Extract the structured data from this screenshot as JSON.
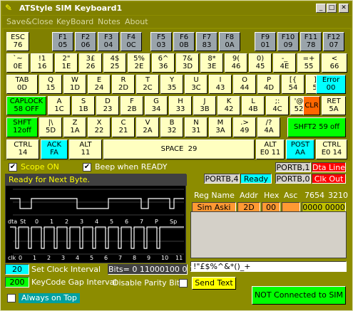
{
  "window": {
    "title": "ATStyle SIM Keyboard1"
  },
  "menu": [
    "Save&Close",
    "KeyBoard",
    "Notes",
    "About"
  ],
  "keyboard": {
    "row0": [
      {
        "t": "ESC",
        "c": "76"
      },
      {
        "t": "F1",
        "c": "05"
      },
      {
        "t": "F2",
        "c": "06"
      },
      {
        "t": "F3",
        "c": "04"
      },
      {
        "t": "F4",
        "c": "0C"
      },
      {
        "t": "F5",
        "c": "03"
      },
      {
        "t": "F6",
        "c": "0B"
      },
      {
        "t": "F7",
        "c": "83"
      },
      {
        "t": "F8",
        "c": "0A"
      },
      {
        "t": "F9",
        "c": "01"
      },
      {
        "t": "F10",
        "c": "09"
      },
      {
        "t": "F11",
        "c": "78"
      },
      {
        "t": "F12",
        "c": "07"
      }
    ],
    "row1": [
      {
        "t": "`~",
        "c": "0E"
      },
      {
        "t": "!1",
        "c": "16"
      },
      {
        "t": "2\"",
        "c": "1E"
      },
      {
        "t": "3£",
        "c": "26"
      },
      {
        "t": "4$",
        "c": "25"
      },
      {
        "t": "5%",
        "c": "2E"
      },
      {
        "t": "6^",
        "c": "36"
      },
      {
        "t": "7&",
        "c": "3D"
      },
      {
        "t": "8*",
        "c": "3E"
      },
      {
        "t": "9(",
        "c": "46"
      },
      {
        "t": "0)",
        "c": "45"
      },
      {
        "t": "-_",
        "c": "4E"
      },
      {
        "t": "=+",
        "c": "55"
      },
      {
        "t": "<",
        "c": "66"
      }
    ],
    "row2": [
      {
        "t": "TAB",
        "c": "0D"
      },
      {
        "t": "Q",
        "c": "15"
      },
      {
        "t": "W",
        "c": "1D"
      },
      {
        "t": "E",
        "c": "24"
      },
      {
        "t": "R",
        "c": "2D"
      },
      {
        "t": "T",
        "c": "2C"
      },
      {
        "t": "Y",
        "c": "35"
      },
      {
        "t": "U",
        "c": "3C"
      },
      {
        "t": "I",
        "c": "43"
      },
      {
        "t": "O",
        "c": "44"
      },
      {
        "t": "P",
        "c": "4D"
      },
      {
        "t": "[{",
        "c": "54"
      },
      {
        "t": "]}",
        "c": "5B"
      },
      {
        "t": "Error",
        "c": "00"
      }
    ],
    "row3": [
      {
        "t": "CAPLOCK",
        "c": "58 OFF"
      },
      {
        "t": "A",
        "c": "1C"
      },
      {
        "t": "S",
        "c": "1B"
      },
      {
        "t": "D",
        "c": "23"
      },
      {
        "t": "F",
        "c": "2B"
      },
      {
        "t": "G",
        "c": "34"
      },
      {
        "t": "H",
        "c": "33"
      },
      {
        "t": "J",
        "c": "3B"
      },
      {
        "t": "K",
        "c": "42"
      },
      {
        "t": "L",
        "c": "4B"
      },
      {
        "t": ";:",
        "c": "4C"
      },
      {
        "t": "'@",
        "c": "52"
      },
      {
        "t": "CLR",
        "c": ""
      },
      {
        "t": "RET",
        "c": "5A"
      }
    ],
    "row4": [
      {
        "t": "SHFT",
        "c": "12off"
      },
      {
        "t": "|\\",
        "c": "5D"
      },
      {
        "t": "Z",
        "c": "1A"
      },
      {
        "t": "X",
        "c": "22"
      },
      {
        "t": "C",
        "c": "21"
      },
      {
        "t": "V",
        "c": "2A"
      },
      {
        "t": "B",
        "c": "32"
      },
      {
        "t": "N",
        "c": "31"
      },
      {
        "t": "M",
        "c": "3A"
      },
      {
        "t": ",<",
        "c": "41"
      },
      {
        "t": ".>",
        "c": "49"
      },
      {
        "t": "/?",
        "c": "4A"
      },
      {
        "t": "SHFT2 59 off",
        "c": ""
      }
    ],
    "row5": [
      {
        "t": "CTRL",
        "c": "14"
      },
      {
        "t": "ACK",
        "c": "FA"
      },
      {
        "t": "ALT",
        "c": "11"
      },
      {
        "t": "SPACE  29",
        "c": ""
      },
      {
        "t": "ALT",
        "c": "E0 11"
      },
      {
        "t": "POST",
        "c": "AA"
      },
      {
        "t": "CTRL",
        "c": "E0 14"
      }
    ]
  },
  "controls": {
    "scope_on": "Scope ON",
    "beep": "Beep when READY",
    "portb1": "PORTB,1",
    "dta_line": "Dta Line",
    "portb4": "PORTB,4",
    "ready": "Ready",
    "portb0": "PORTB,0",
    "clk_out": "Clk Out"
  },
  "scope": {
    "status": "Ready for Next Byte.",
    "dta_label": "dta",
    "clk_label": "clk",
    "dta_ticks": [
      "St",
      "0",
      "1",
      "2",
      "3",
      "4",
      "5",
      "6",
      "7",
      "P",
      "Sp"
    ],
    "clk_ticks": [
      "0",
      "1",
      "2",
      "3",
      "4",
      "5",
      "6",
      "7",
      "8",
      "9",
      "10",
      "11"
    ]
  },
  "reg": {
    "headers": [
      "Reg Name",
      "Addr",
      "Hex",
      "Asc",
      "7654",
      "3210"
    ],
    "name": "Sim Aski",
    "addr": "2D",
    "hex": "00",
    "asc": "",
    "bits": "0000  0000"
  },
  "text_field": "!\"£$%^&*()_+",
  "clock": {
    "interval_value": "20",
    "interval_label": "Set Clock Interval",
    "gap_value": "200",
    "gap_label": "KeyCode Gap Interval",
    "bits_label": "Bits= 0  11000100  0 1"
  },
  "parity_label": "Disable Parity Bit.",
  "send_text": "Send Text",
  "always_on_top": "Always on Top",
  "sim_status": "NOT Connected to SIM",
  "colors": {
    "bg": "#808000",
    "key": "#ffffc0",
    "fkey": "#9aa4aa",
    "green": "#00ff00",
    "cyan": "#00ffff",
    "red": "#ff0000",
    "orange": "#ff9933"
  }
}
